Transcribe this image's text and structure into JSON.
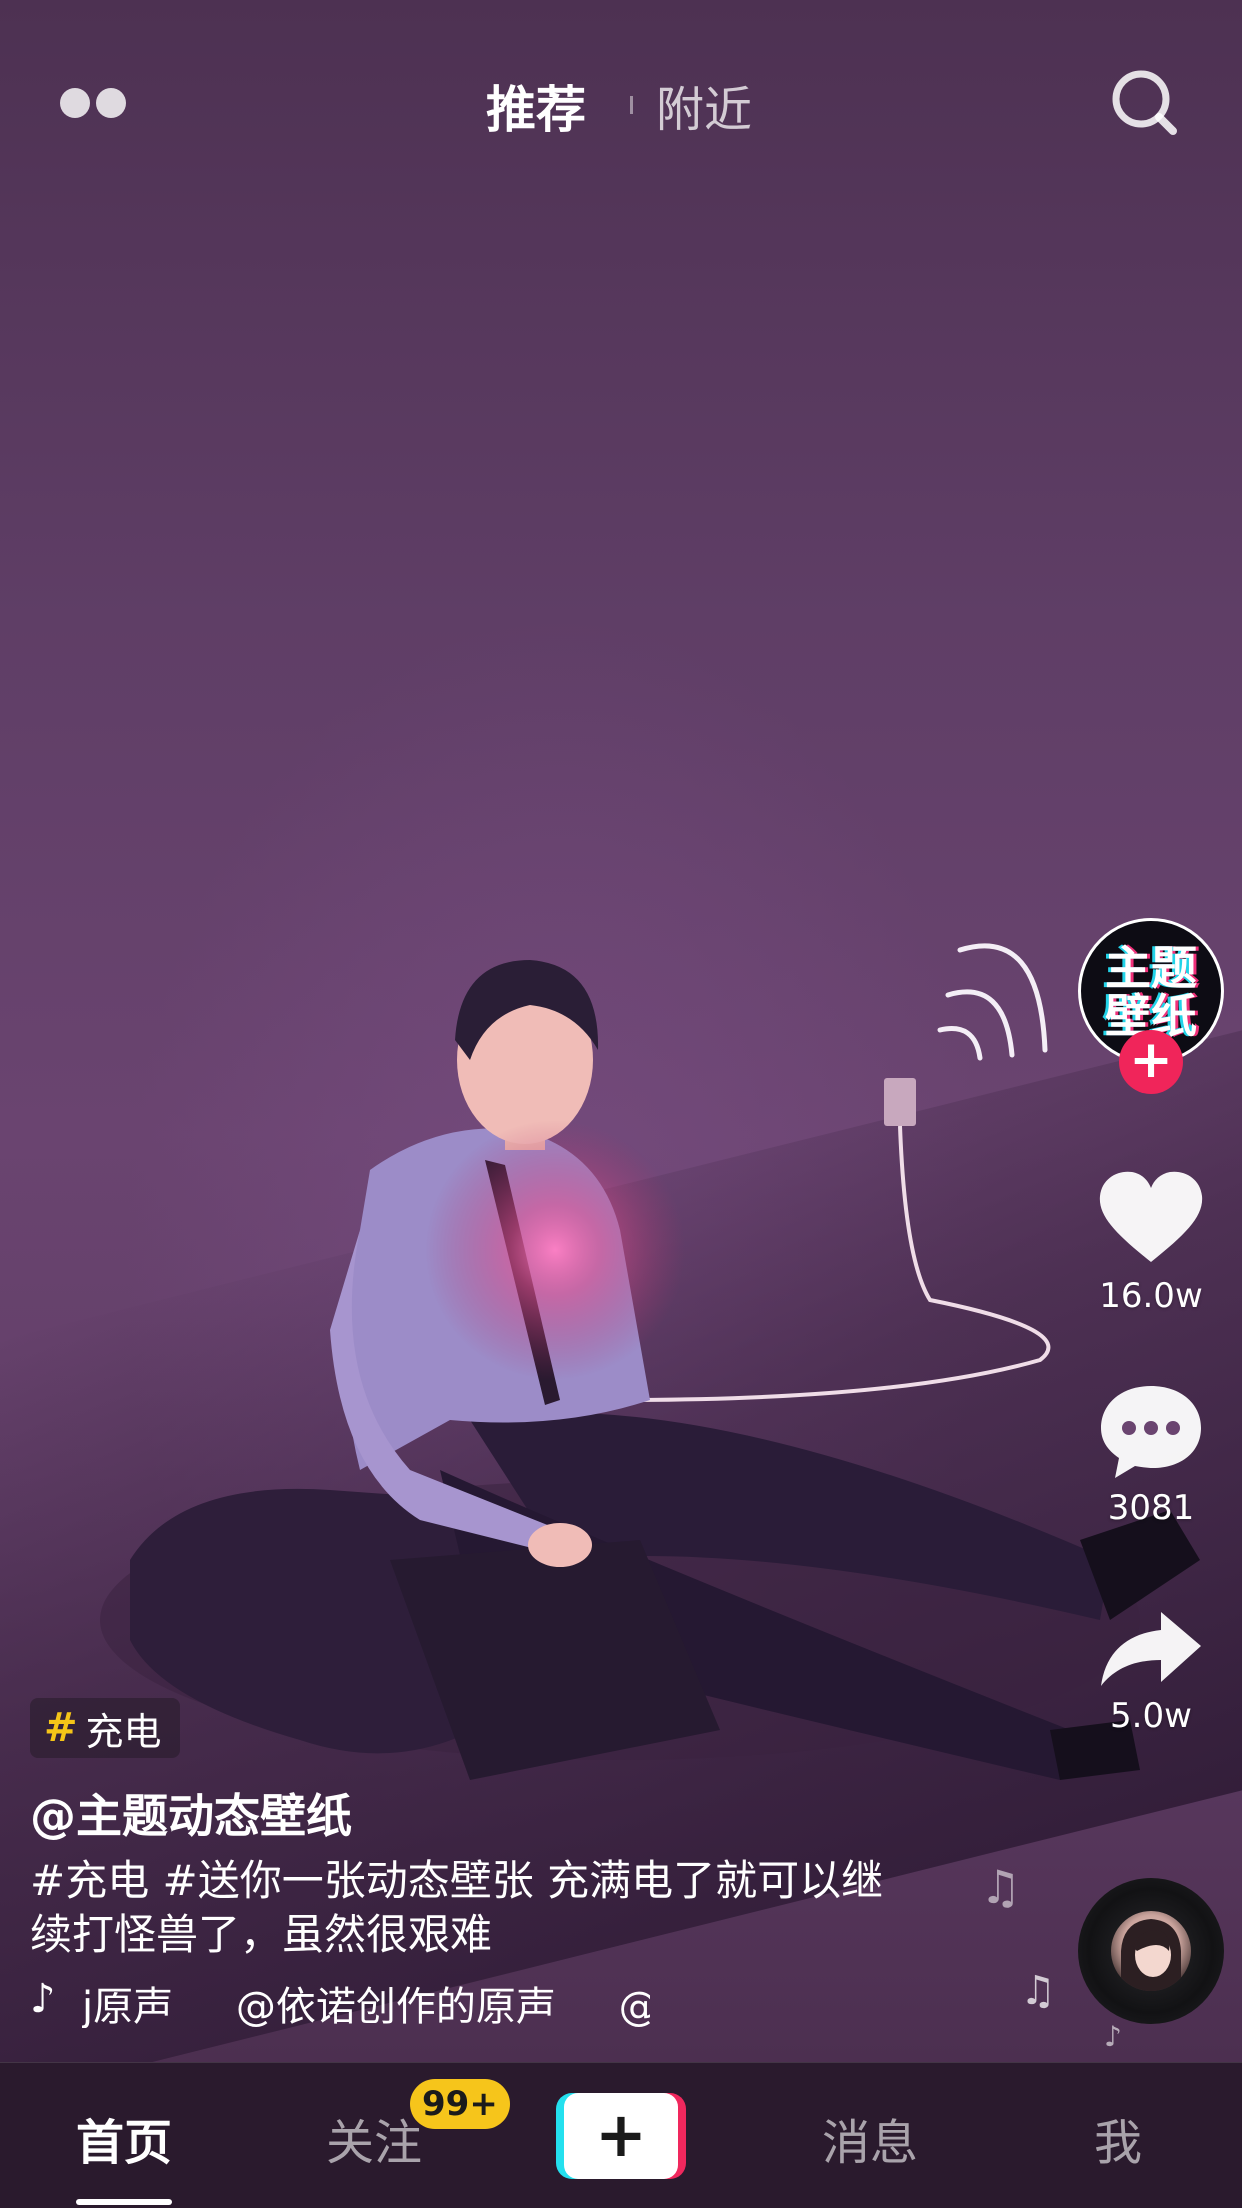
{
  "top_bar": {
    "tab_recommend": "推荐",
    "tab_nearby": "附近"
  },
  "video": {
    "author_avatar_text": [
      "主题",
      "壁纸"
    ],
    "follow_symbol": "+",
    "like_count": "16.0w",
    "comment_count": "3081",
    "share_count": "5.0w",
    "hashtag_chip": "充电",
    "hashtag_symbol": "#",
    "author": "@主题动态壁纸",
    "caption_line1": "#充电 #送你一张动态壁张  充满电了就可以继",
    "caption_line2": "续打怪兽了，虽然很艰难",
    "music_text": "j原声",
    "music_text_2": "@依诺创作的原声",
    "music_text_3": "@"
  },
  "tab_bar": {
    "home": "首页",
    "follow": "关注",
    "follow_badge": "99+",
    "create": "+",
    "messages": "消息",
    "me": "我"
  },
  "colors": {
    "accent_red": "#f0255a",
    "accent_cyan": "#24e0ee",
    "badge_yellow": "#f6c51b",
    "hashtag_yellow": "#f5c518"
  },
  "icons": [
    "camera-dots-icon",
    "search-icon",
    "heart-icon",
    "comment-icon",
    "share-icon",
    "music-note-icon",
    "music-disc-icon"
  ]
}
